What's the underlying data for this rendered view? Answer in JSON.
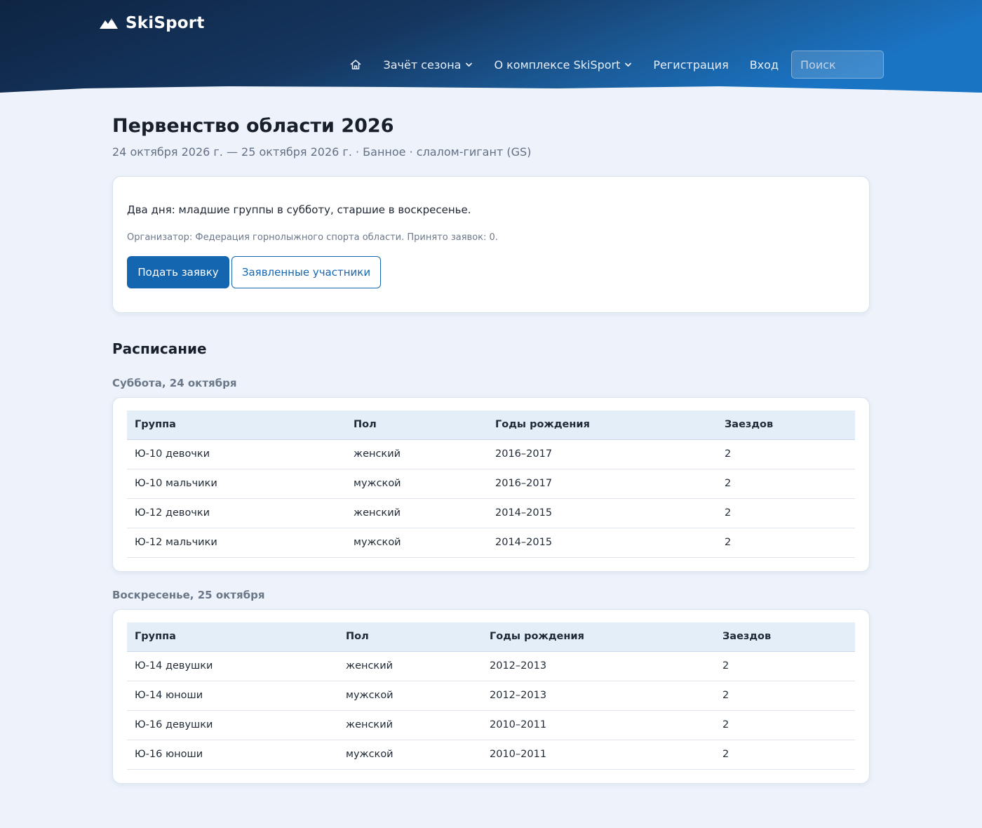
{
  "header": {
    "brand": "SkiSport",
    "colors": {
      "header_dark": "#0e2443",
      "header_light": "#1a72c0",
      "accent": "#1466b0"
    },
    "nav": {
      "home_icon": "home-icon",
      "season": "Зачёт сезона",
      "about": "О комплексе SkiSport",
      "register": "Регистрация",
      "login": "Вход"
    },
    "search": {
      "placeholder": "Поиск",
      "value": ""
    }
  },
  "event": {
    "title": "Первенство области 2026",
    "subtitle": "24 октября 2026 г. — 25 октября 2026 г. · Банное · слалом-гигант (GS)",
    "description": "Два дня: младшие группы в субботу, старшие в воскресенье.",
    "meta": "Организатор: Федерация горнолыжного спорта области. Принято заявок: 0.",
    "apply_button": "Подать заявку",
    "participants_button": "Заявленные участники"
  },
  "schedule": {
    "title": "Расписание",
    "columns": [
      "Группа",
      "Пол",
      "Годы рождения",
      "Заездов"
    ],
    "days": [
      {
        "title": "Суббота, 24 октября",
        "rows": [
          [
            "Ю-10 девочки",
            "женский",
            "2016–2017",
            "2"
          ],
          [
            "Ю-10 мальчики",
            "мужской",
            "2016–2017",
            "2"
          ],
          [
            "Ю-12 девочки",
            "женский",
            "2014–2015",
            "2"
          ],
          [
            "Ю-12 мальчики",
            "мужской",
            "2014–2015",
            "2"
          ]
        ]
      },
      {
        "title": "Воскресенье, 25 октября",
        "rows": [
          [
            "Ю-14 девушки",
            "женский",
            "2012–2013",
            "2"
          ],
          [
            "Ю-14 юноши",
            "мужской",
            "2012–2013",
            "2"
          ],
          [
            "Ю-16 девушки",
            "женский",
            "2010–2011",
            "2"
          ],
          [
            "Ю-16 юноши",
            "мужской",
            "2010–2011",
            "2"
          ]
        ]
      }
    ]
  }
}
